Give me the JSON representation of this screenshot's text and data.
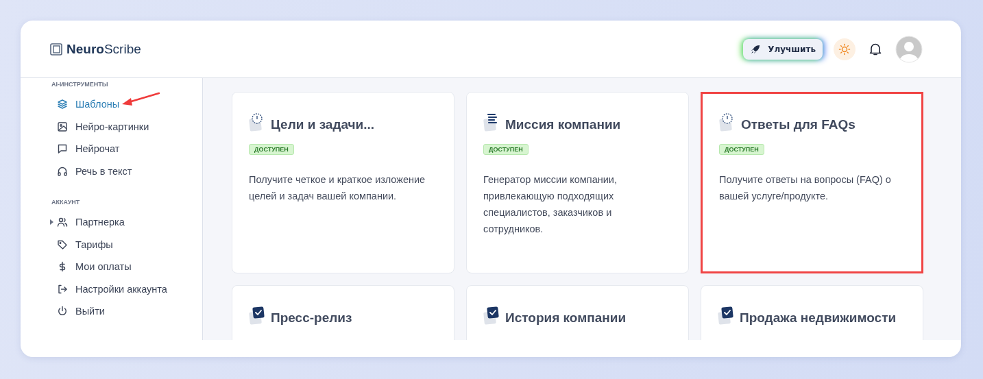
{
  "logo": {
    "bold": "Neuro",
    "light": "Scribe"
  },
  "header": {
    "upgrade_button": "Улучшить"
  },
  "sidebar": {
    "sections": [
      {
        "title": "AI-ИНСТРУМЕНТЫ",
        "items": [
          {
            "label": "Шаблоны",
            "selected": true,
            "annotated": true
          },
          {
            "label": "Нейро-картинки",
            "selected": false
          },
          {
            "label": "Нейрочат",
            "selected": false
          },
          {
            "label": "Речь в текст",
            "selected": false
          }
        ]
      },
      {
        "title": "АККАУНТ",
        "items": [
          {
            "label": "Партнерка",
            "selected": false,
            "expanded": false
          },
          {
            "label": "Тарифы",
            "selected": false
          },
          {
            "label": "Мои оплаты",
            "selected": false
          },
          {
            "label": "Настройки аккаунта",
            "selected": false
          },
          {
            "label": "Выйти",
            "selected": false
          }
        ]
      }
    ]
  },
  "cards": [
    {
      "title": "Цели и задачи...",
      "badge": "ДОСТУПЕН",
      "description": "Получите четкое и краткое изложение целей и задач вашей компании.",
      "highlighted": false
    },
    {
      "title": "Миссия компании",
      "badge": "ДОСТУПЕН",
      "description": "Генератор миссии компании, привлекающую подходящих специалистов, заказчиков и сотрудников.",
      "highlighted": false
    },
    {
      "title": "Ответы для FAQs",
      "badge": "ДОСТУПЕН",
      "description": "Получите ответы на вопросы (FAQ) о вашей услуге/продукте.",
      "highlighted": true
    },
    {
      "title": "Пресс-релиз",
      "highlighted": false
    },
    {
      "title": "История компании",
      "highlighted": false
    },
    {
      "title": "Продажа недвижимости",
      "highlighted": false
    }
  ]
}
